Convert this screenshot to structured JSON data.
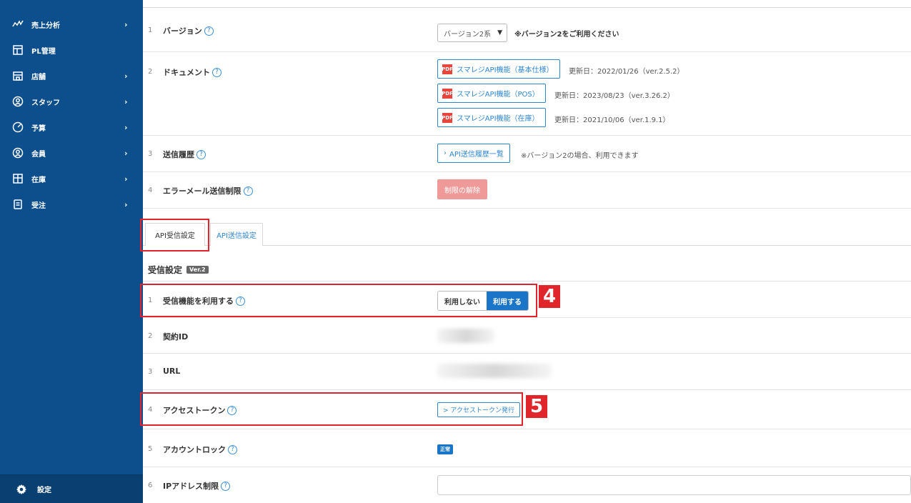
{
  "sidebar": {
    "items": [
      {
        "label": "売上分析",
        "icon": "trend-line-icon"
      },
      {
        "label": "PL管理",
        "icon": "ledger-icon"
      },
      {
        "label": "店舗",
        "icon": "store-icon"
      },
      {
        "label": "スタッフ",
        "icon": "staff-icon"
      },
      {
        "label": "予算",
        "icon": "budget-gauge-icon"
      },
      {
        "label": "会員",
        "icon": "member-icon"
      },
      {
        "label": "在庫",
        "icon": "inventory-grid-icon"
      },
      {
        "label": "受注",
        "icon": "order-icon"
      }
    ],
    "chevron": "›",
    "settings_label": "設定"
  },
  "rows_top": [
    {
      "num": "1",
      "label": "バージョン"
    },
    {
      "num": "2",
      "label": "ドキュメント"
    },
    {
      "num": "3",
      "label": "送信履歴"
    },
    {
      "num": "4",
      "label": "エラーメール送信制限"
    }
  ],
  "version": {
    "selected": "バージョン2系",
    "note": "※バージョン2をご利用ください"
  },
  "documents": [
    {
      "label": "スマレジAPI機能（基本仕様）",
      "updated": "更新日：2022/01/26（ver.2.5.2）"
    },
    {
      "label": "スマレジAPI機能（POS）",
      "updated": "更新日：2023/08/23（ver.3.26.2）"
    },
    {
      "label": "スマレジAPI機能（在庫）",
      "updated": "更新日：2021/10/06（ver.1.9.1）"
    }
  ],
  "send_history": {
    "button": "API送信履歴一覧",
    "note": "※バージョン2の場合、利用できます"
  },
  "error_mail": {
    "button": "制限の解除"
  },
  "tabs": [
    {
      "label": "API受信設定"
    },
    {
      "label": "API送信設定"
    }
  ],
  "receive": {
    "title": "受信設定",
    "badge": "Ver.2",
    "rows": [
      {
        "num": "1",
        "label": "受信機能を利用する"
      },
      {
        "num": "2",
        "label": "契約ID"
      },
      {
        "num": "3",
        "label": "URL"
      },
      {
        "num": "4",
        "label": "アクセストークン"
      },
      {
        "num": "5",
        "label": "アカウントロック"
      },
      {
        "num": "6",
        "label": "IPアドレス制限"
      }
    ],
    "toggle_off": "利用しない",
    "toggle_on": "利用する",
    "token_button": "> アクセストークン発行",
    "lock_status": "正常"
  },
  "markers": {
    "step4": "4",
    "step5": "5"
  },
  "colors": {
    "sidebar": "#0d4f8c",
    "accent": "#2f86d0",
    "highlight": "#e0262b",
    "disabled": "#ef9999"
  }
}
